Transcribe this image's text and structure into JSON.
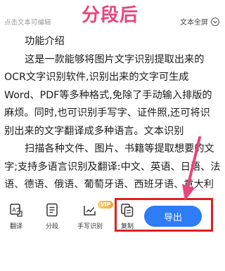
{
  "header": {
    "hint": "点击文本可编辑",
    "overlay_title": "分段后",
    "fullscreen_label": "文本全屏"
  },
  "content": {
    "lines": [
      "功能介绍",
      "这是一款能够将图片文字识别提取出来的",
      "OCR文字识别软件,识别出来的文字可生成",
      "Word、PDF等多种格式,免除了手动输入排版的",
      "麻烦。同时,也可识别手写字、证件照,还可将识",
      "别出来的文字翻译成多种语言。文本识别",
      "扫描各种文件、图片、书籍等提取想要的文",
      "字;支持多语言识别及翻译:中文、英语、日语、法",
      "语、德语、俄语、葡萄牙语、西班牙语、意大利"
    ]
  },
  "toolbar": {
    "translate_label": "翻译",
    "segment_label": "分段",
    "handwriting_label": "手写识别",
    "vip_badge": "VIP",
    "copy_label": "复制",
    "export_label": "导出"
  },
  "colors": {
    "accent": "#2e7cf6",
    "annotation_red": "#e02020",
    "annotation_pink": "#e8457a"
  },
  "icons": [
    "chevron-down-icon",
    "translate-icon",
    "segment-icon",
    "handwriting-icon",
    "copy-icon",
    "arrow-annotation-icon"
  ]
}
